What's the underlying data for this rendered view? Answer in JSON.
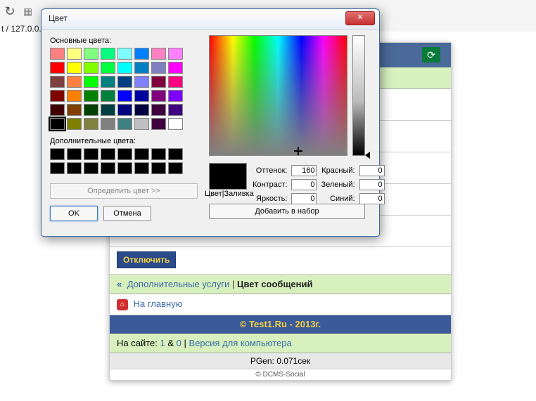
{
  "browser": {
    "address": "t / 127.0.0.1"
  },
  "page": {
    "disable_btn": "Отключить",
    "breadcrumb_link": "Дополнительные услуги",
    "breadcrumb_current": "Цвет сообщений",
    "home_link": "На главную",
    "copyright": "© Test1.Ru - 2013г.",
    "online_prefix": "На сайте:",
    "online_n1": "1",
    "online_amp": "&",
    "online_n2": "0",
    "online_sep": "|",
    "online_version": "Версия для компьютера",
    "pgen": "PGen: 0.071сек",
    "dcms": "© DCMS-Social"
  },
  "dialog": {
    "title": "Цвет",
    "basic_label": "Основные цвета:",
    "custom_label": "Дополнительные цвета:",
    "define_btn": "Определить цвет >>",
    "ok": "OK",
    "cancel": "Отмена",
    "sample_label": "Цвет|Заливка",
    "hue_label": "Оттенок:",
    "sat_label": "Контраст:",
    "lum_label": "Яркость:",
    "red_label": "Красный:",
    "green_label": "Зеленый:",
    "blue_label": "Синий:",
    "hue": "160",
    "sat": "0",
    "lum": "0",
    "red": "0",
    "green": "0",
    "blue": "0",
    "add_btn": "Добавить в набор",
    "basic_colors": [
      [
        "#ff8080",
        "#ffff80",
        "#80ff80",
        "#00ff80",
        "#80ffff",
        "#0080ff",
        "#ff80c0",
        "#ff80ff"
      ],
      [
        "#ff0000",
        "#ffff00",
        "#80ff00",
        "#00ff40",
        "#00ffff",
        "#0080c0",
        "#8080c0",
        "#ff00ff"
      ],
      [
        "#804040",
        "#ff8040",
        "#00ff00",
        "#008080",
        "#004080",
        "#8080ff",
        "#800040",
        "#ff0080"
      ],
      [
        "#800000",
        "#ff8000",
        "#008000",
        "#008040",
        "#0000ff",
        "#0000a0",
        "#800080",
        "#8000ff"
      ],
      [
        "#400000",
        "#804000",
        "#004000",
        "#004040",
        "#000080",
        "#000040",
        "#400040",
        "#400080"
      ],
      [
        "#000000",
        "#808000",
        "#808040",
        "#808080",
        "#408080",
        "#c0c0c0",
        "#400040",
        "#ffffff"
      ]
    ],
    "selected_row": 5,
    "selected_col": 0
  }
}
